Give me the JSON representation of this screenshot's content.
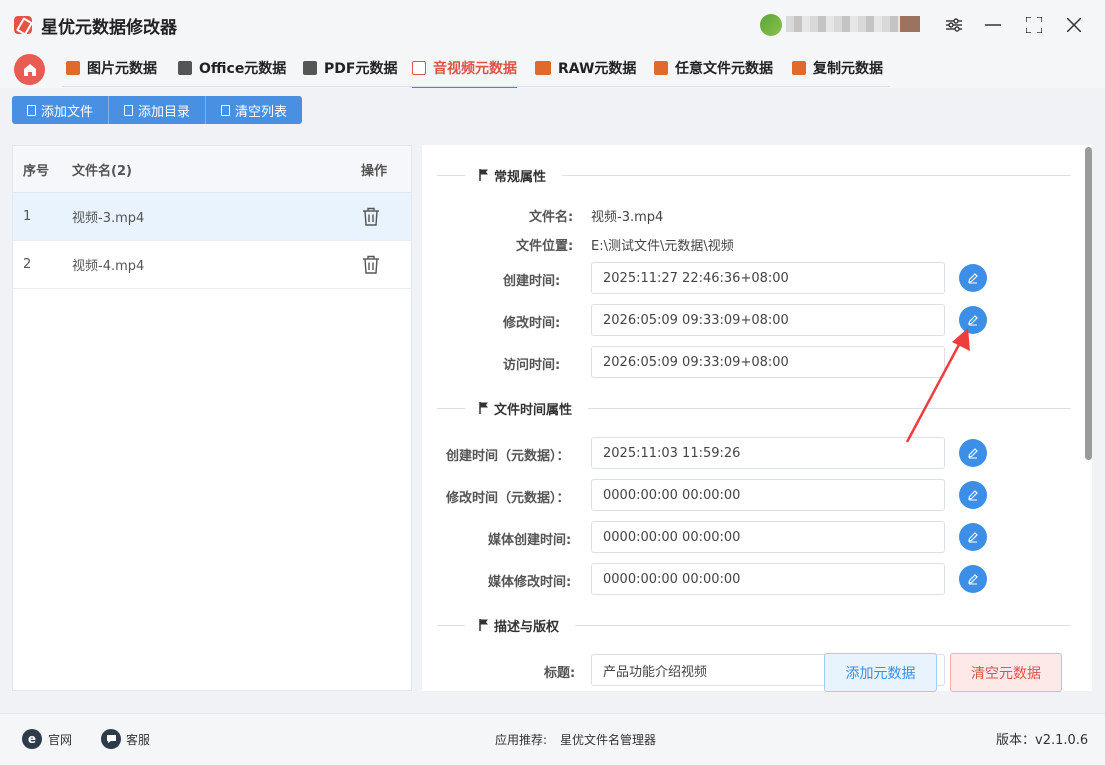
{
  "app": {
    "title": "星优元数据修改器"
  },
  "window_controls": {
    "settings": "⚙",
    "minimize": "—",
    "maximize": "⛶",
    "close": "✕"
  },
  "tabs": [
    {
      "label": "图片元数据",
      "icon": "image-icon",
      "color": "#e06a2b"
    },
    {
      "label": "Office元数据",
      "icon": "office-icon",
      "color": "#555555"
    },
    {
      "label": "PDF元数据",
      "icon": "pdf-icon",
      "color": "#555555"
    },
    {
      "label": "音视频元数据",
      "icon": "video-icon",
      "color": "#e0534a",
      "active": true
    },
    {
      "label": "RAW元数据",
      "icon": "raw-icon",
      "color": "#e06a2b"
    },
    {
      "label": "任意文件元数据",
      "icon": "file-icon",
      "color": "#e06a2b"
    },
    {
      "label": "复制元数据",
      "icon": "copy-icon",
      "color": "#e06a2b"
    }
  ],
  "toolbar": {
    "add_file": "添加文件",
    "add_dir": "添加目录",
    "clear_list": "清空列表"
  },
  "file_table": {
    "headers": {
      "index": "序号",
      "name": "文件名(2)",
      "op": "操作"
    },
    "rows": [
      {
        "index": "1",
        "name": "视频-3.mp4",
        "selected": true
      },
      {
        "index": "2",
        "name": "视频-4.mp4",
        "selected": false
      }
    ]
  },
  "sections": {
    "general": "常规属性",
    "file_time": "文件时间属性",
    "desc": "描述与版权"
  },
  "general": {
    "file_name_label": "文件名:",
    "file_name": "视频-3.mp4",
    "file_path_label": "文件位置:",
    "file_path": "E:\\测试文件\\元数据\\视频",
    "created_label": "创建时间:",
    "created": "2025:11:27 22:46:36+08:00",
    "modified_label": "修改时间:",
    "modified": "2026:05:09 09:33:09+08:00",
    "accessed_label": "访问时间:",
    "accessed": "2026:05:09 09:33:09+08:00"
  },
  "file_time": {
    "meta_created_label": "创建时间（元数据）：",
    "meta_created": "2025:11:03 11:59:26",
    "meta_modified_label": "修改时间（元数据）：",
    "meta_modified": "0000:00:00 00:00:00",
    "media_created_label": "媒体创建时间:",
    "media_created": "0000:00:00 00:00:00",
    "media_modified_label": "媒体修改时间:",
    "media_modified": "0000:00:00 00:00:00"
  },
  "desc": {
    "title_label": "标题:",
    "title_value": "产品功能介绍视频"
  },
  "actions": {
    "add_meta": "添加元数据",
    "clear_meta": "清空元数据"
  },
  "footer": {
    "website_icon": "e",
    "website": "官网",
    "service": "客服",
    "recommend_label": "应用推荐:",
    "recommend_app": "星优文件名管理器",
    "version": "版本：v2.1.0.6"
  },
  "colors": {
    "accent": "#e0534a",
    "primary": "#4a90e2",
    "edit": "#3d8ee6"
  }
}
